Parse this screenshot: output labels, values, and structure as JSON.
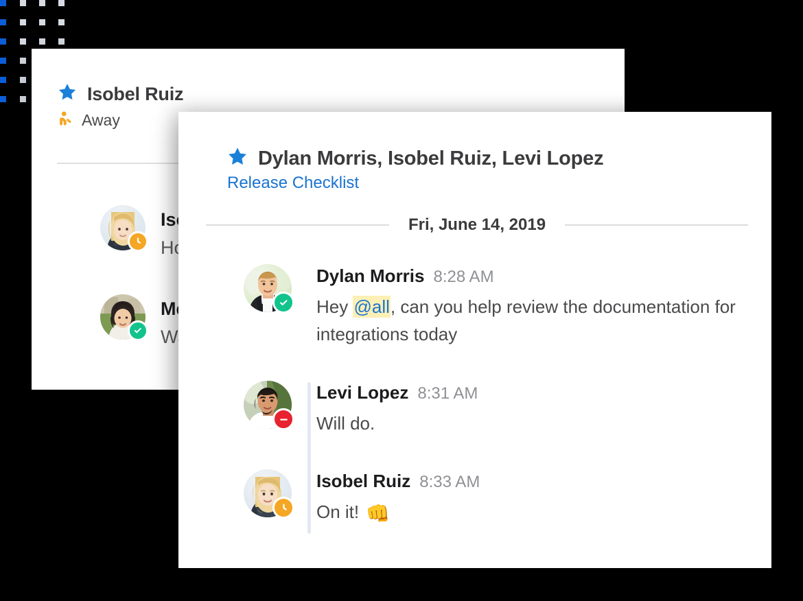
{
  "theme": {
    "background": "#000000",
    "card_background": "#ffffff",
    "accent_blue": "#1a73d1",
    "dot_blue": "#0b5ed7",
    "dot_grey": "#d6dbe3",
    "mention_highlight": "#fdf0b4",
    "status_away": "#f5a623",
    "status_available": "#12c48b",
    "status_busy": "#e8222f",
    "thread_line": "#e2e8f2"
  },
  "back_card": {
    "header": {
      "star_icon": "star-icon",
      "title": "Isobel Ruiz",
      "status_icon": "away-person-icon",
      "status_label": "Away"
    },
    "messages": [
      {
        "avatar": "avatar-isobel-ruiz",
        "badge": "clock-icon",
        "badge_status": "away",
        "name": "Isobel Ruiz",
        "text": "Ho"
      },
      {
        "avatar": "avatar-mei-chen",
        "badge": "check-icon",
        "badge_status": "available",
        "name": "Me",
        "text": "Wa"
      }
    ]
  },
  "front_card": {
    "header": {
      "star_icon": "star-icon",
      "title": "Dylan Morris, Isobel Ruiz, Levi Lopez",
      "subtitle": "Release Checklist"
    },
    "date_divider": {
      "label": "Fri, June 14, 2019"
    },
    "messages": [
      {
        "avatar": "avatar-dylan-morris",
        "badge": "check-icon",
        "badge_status": "available",
        "name": "Dylan Morris",
        "time": "8:28 AM",
        "text_before": "Hey ",
        "mention": "@all",
        "text_after": ", can you help review the documentation for integrations today",
        "threaded": false
      },
      {
        "avatar": "avatar-levi-lopez",
        "badge": "minus-icon",
        "badge_status": "busy",
        "name": "Levi Lopez",
        "time": "8:31 AM",
        "text": "Will do.",
        "threaded": true
      },
      {
        "avatar": "avatar-isobel-ruiz",
        "badge": "clock-icon",
        "badge_status": "away",
        "name": "Isobel Ruiz",
        "time": "8:33 AM",
        "text": "On it!",
        "emoji": "👊",
        "threaded": true
      }
    ]
  }
}
